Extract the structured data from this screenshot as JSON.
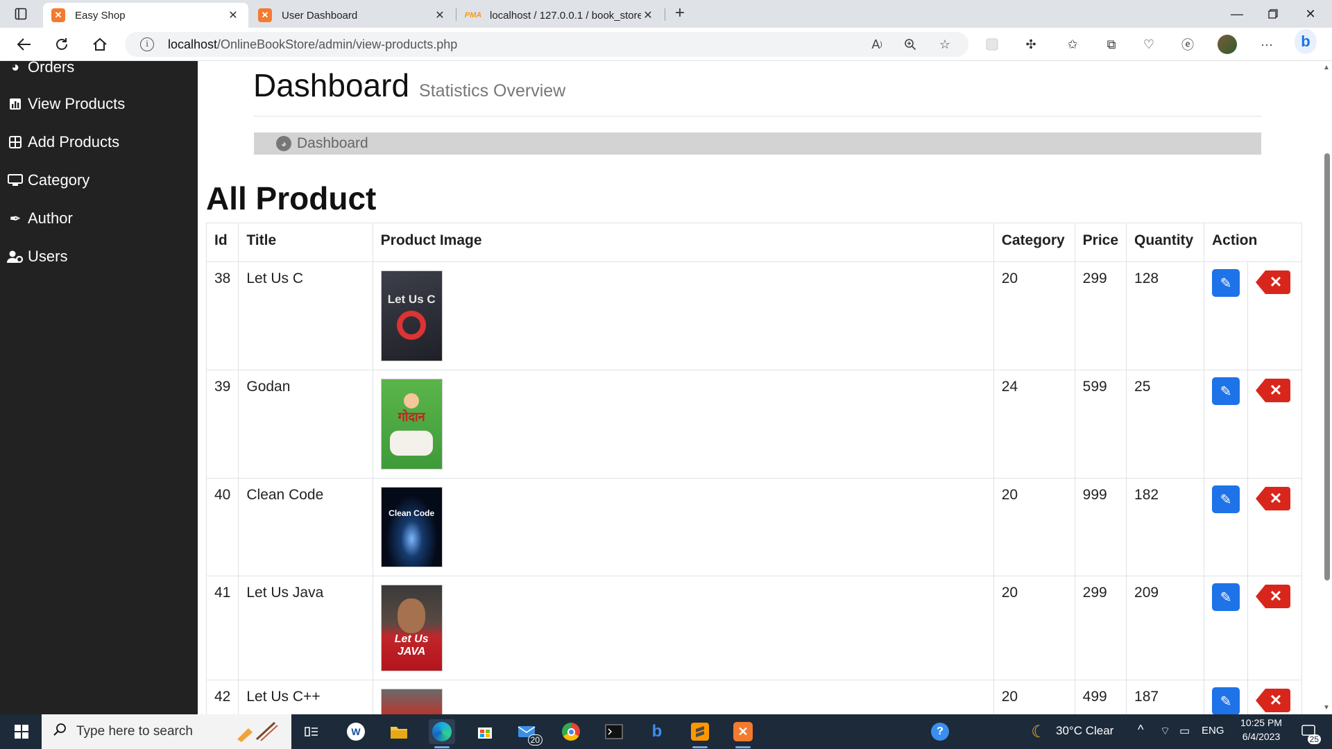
{
  "browser": {
    "tabs": [
      {
        "title": "Easy Shop",
        "active": true,
        "favicon": "xampp-icon"
      },
      {
        "title": "User Dashboard",
        "active": false,
        "favicon": "xampp-icon"
      },
      {
        "title": "localhost / 127.0.0.1 / book_store",
        "active": false,
        "favicon": "phpmyadmin-icon"
      }
    ],
    "favicon_pma_text": "PMA",
    "url_host": "localhost",
    "url_path": "/OnlineBookStore/admin/view-products.php"
  },
  "sidebar": {
    "items": [
      {
        "label": "Orders",
        "icon": "dashboard-icon"
      },
      {
        "label": "View Products",
        "icon": "bar-chart-icon"
      },
      {
        "label": "Add Products",
        "icon": "table-icon"
      },
      {
        "label": "Category",
        "icon": "desktop-icon"
      },
      {
        "label": "Author",
        "icon": "feather-icon"
      },
      {
        "label": "Users",
        "icon": "users-cog-icon"
      }
    ]
  },
  "header": {
    "title": "Dashboard",
    "subtitle": "Statistics Overview",
    "breadcrumb": "Dashboard"
  },
  "products": {
    "title": "All Product",
    "columns": [
      "Id",
      "Title",
      "Product Image",
      "Category",
      "Price",
      "Quantity",
      "Action"
    ],
    "rows": [
      {
        "id": "38",
        "title": "Let Us C",
        "category": "20",
        "price": "299",
        "quantity": "128",
        "cover_text": "Let Us C"
      },
      {
        "id": "39",
        "title": "Godan",
        "category": "24",
        "price": "599",
        "quantity": "25",
        "cover_text": "गोदान"
      },
      {
        "id": "40",
        "title": "Clean Code",
        "category": "20",
        "price": "999",
        "quantity": "182",
        "cover_text": "Clean Code"
      },
      {
        "id": "41",
        "title": "Let Us Java",
        "category": "20",
        "price": "299",
        "quantity": "209",
        "cover_text": "Let Us JAVA"
      },
      {
        "id": "42",
        "title": "Let Us C++",
        "category": "20",
        "price": "499",
        "quantity": "187",
        "cover_text": ""
      }
    ]
  },
  "taskbar": {
    "search_placeholder": "Type here to search",
    "mail_badge": "20",
    "weather": "30°C  Clear",
    "language": "ENG",
    "time": "10:25 PM",
    "date": "6/4/2023",
    "notification_count": "25"
  },
  "colors": {
    "sidebar_bg": "#222222",
    "edit_button": "#1e73e8",
    "delete_button": "#d9261c",
    "breadcrumb_bg": "#d3d3d3"
  }
}
